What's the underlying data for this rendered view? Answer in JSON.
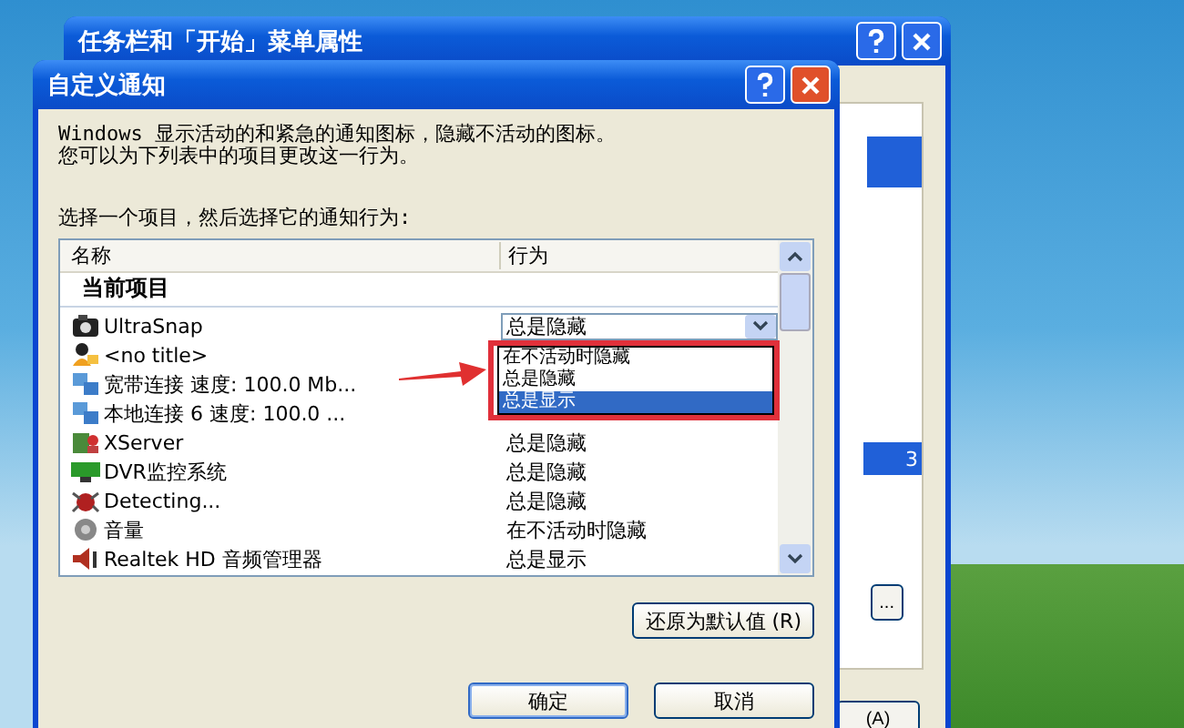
{
  "back_window": {
    "title": "任务栏和「开始」菜单属性",
    "panel_text": "3",
    "buttons": [
      {
        "label": "..."
      },
      {
        "label": "(A)"
      }
    ]
  },
  "dialog": {
    "title": "自定义通知",
    "description": [
      "Windows 显示活动的和紧急的通知图标，隐藏不活动的图标。",
      "您可以为下列表中的项目更改这一行为。"
    ],
    "instruction": "选择一个项目，然后选择它的通知行为:",
    "table": {
      "columns": [
        "名称",
        "行为"
      ],
      "group": "当前项目",
      "rows": [
        {
          "kind": "camera",
          "name": "UltraSnap",
          "behavior": "总是隐藏",
          "selected": true
        },
        {
          "kind": "person",
          "name": "<no title>",
          "selected": false
        },
        {
          "kind": "network",
          "name": "宽带连接 速度: 100.0 Mb...",
          "selected": false
        },
        {
          "kind": "network",
          "name": "本地连接 6 速度: 100.0 ...",
          "selected": false
        },
        {
          "kind": "server",
          "name": "XServer",
          "behavior": "总是隐藏",
          "selected": false
        },
        {
          "kind": "monitor",
          "name": "DVR监控系统",
          "behavior": "总是隐藏",
          "selected": false
        },
        {
          "kind": "bug",
          "name": "Detecting...",
          "behavior": "总是隐藏",
          "selected": false
        },
        {
          "kind": "speaker",
          "name": "音量",
          "behavior": "在不活动时隐藏",
          "selected": false
        },
        {
          "kind": "audio",
          "name": "Realtek HD 音频管理器",
          "behavior": "总是显示",
          "selected": false
        }
      ]
    },
    "dropdown_options": [
      {
        "label": "在不活动时隐藏",
        "selected": false
      },
      {
        "label": "总是隐藏",
        "selected": false
      },
      {
        "label": "总是显示",
        "selected": true
      }
    ],
    "restore_button": "还原为默认值 (R)",
    "ok_button": "确定",
    "cancel_button": "取消"
  }
}
